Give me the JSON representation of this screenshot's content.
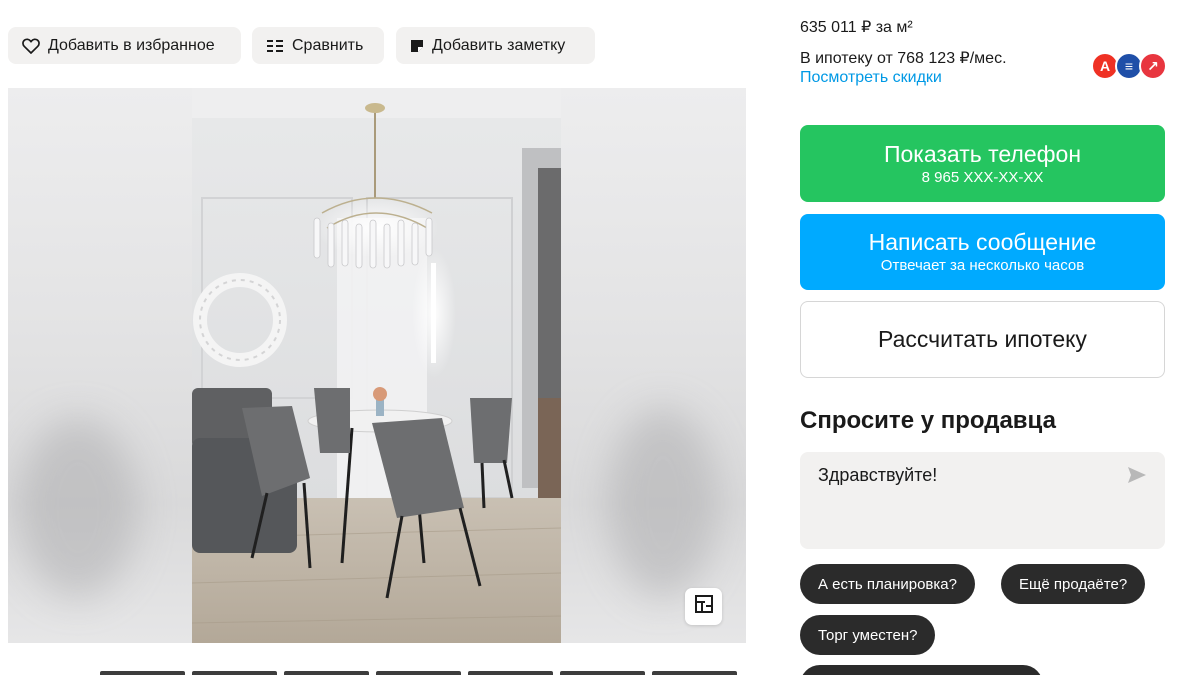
{
  "actions": {
    "favorite_label": "Добавить в избранное",
    "compare_label": "Сравнить",
    "note_label": "Добавить заметку"
  },
  "pricing": {
    "per_m2": "635 011 ₽ за м²",
    "mortgage_from": "В ипотеку от 768 123 ₽/мес.",
    "discounts_link": "Посмотреть скидки"
  },
  "banks": [
    {
      "name": "alfa-bank-logo",
      "glyph": "А",
      "color": "#ef3124"
    },
    {
      "name": "bank-logo-blue",
      "glyph": "≡",
      "color": "#1f4fa8"
    },
    {
      "name": "bank-logo-red",
      "glyph": "↗",
      "color": "#e8363f"
    }
  ],
  "contact": {
    "phone_title": "Показать телефон",
    "phone_masked": "8 965 XXX-XX-XX",
    "message_title": "Написать сообщение",
    "message_sub": "Отвечает за несколько часов",
    "mortgage_calc": "Рассчитать ипотеку"
  },
  "ask_seller": {
    "title": "Спросите у продавца",
    "message_value": "Здравствуйте!",
    "chips": [
      "А есть планировка?",
      "Ещё продаёте?",
      "Торг уместен?"
    ]
  },
  "colors": {
    "accent_green": "#25c560",
    "accent_blue": "#00aaff",
    "link_blue": "#0099e5",
    "chip_dark": "#2b2b2b"
  }
}
